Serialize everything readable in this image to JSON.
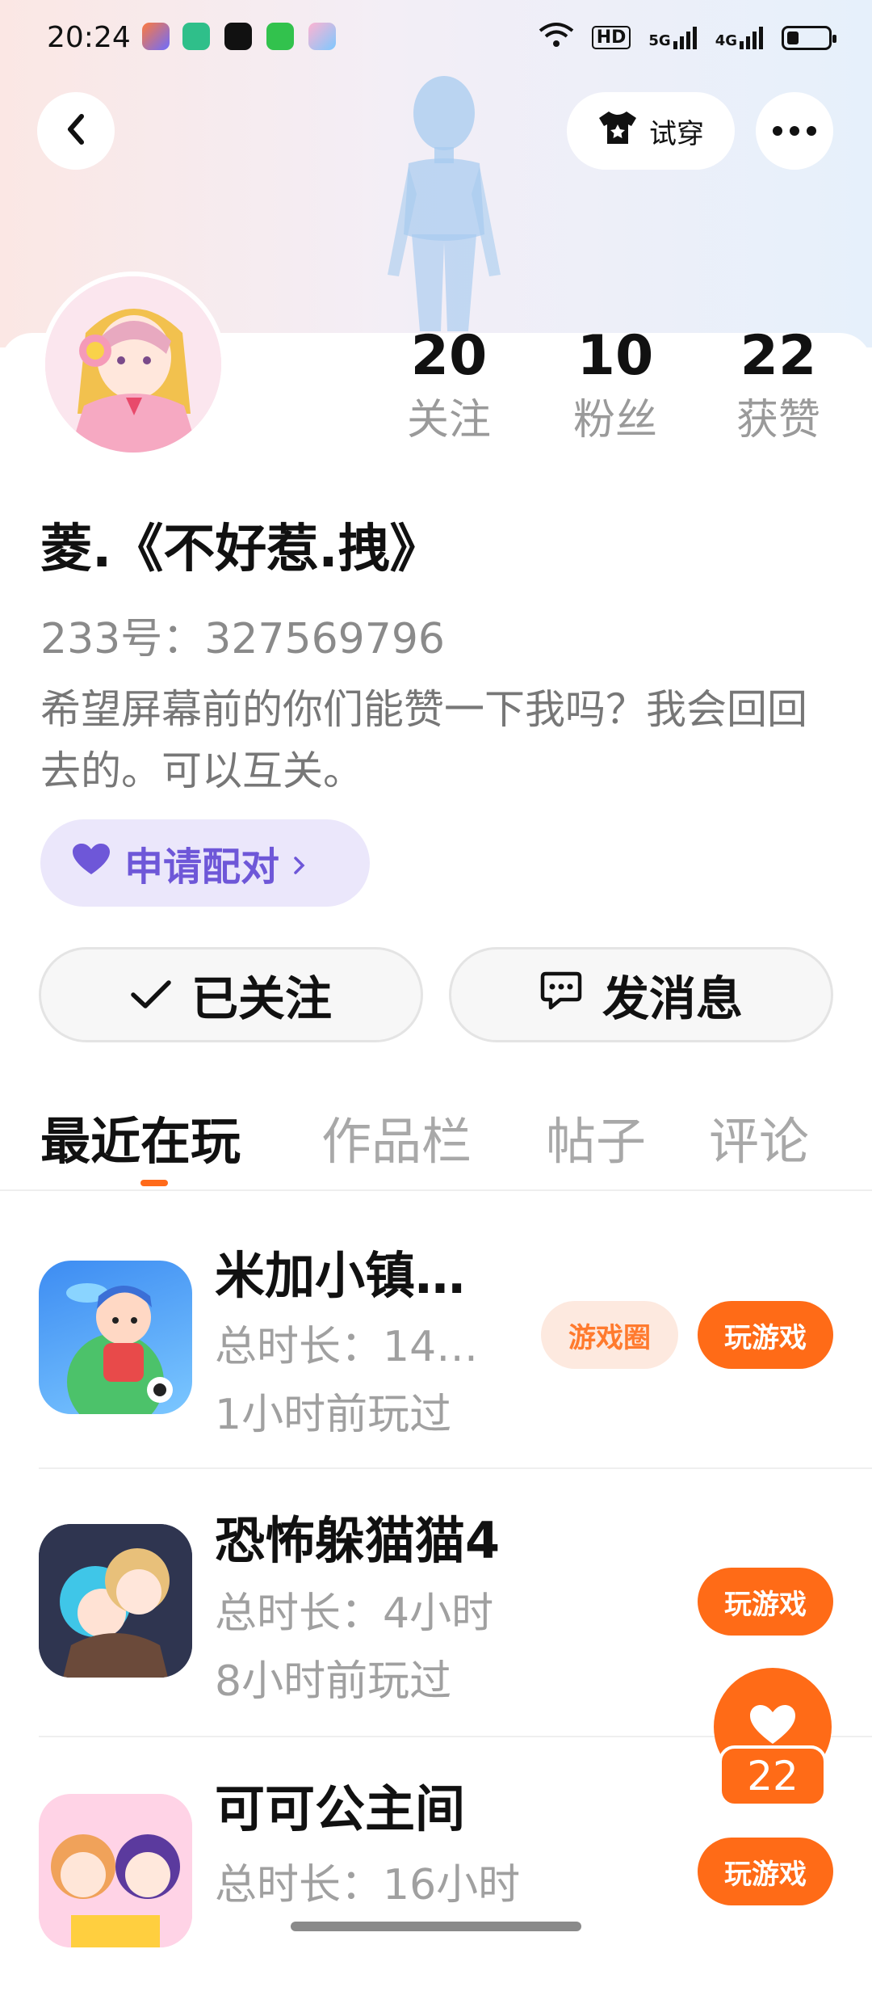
{
  "status_bar": {
    "time": "20:24",
    "network_1": "HD",
    "network_2": "5G",
    "network_3": "4G"
  },
  "header": {
    "back_icon": "chevron-left-icon",
    "try_on_label": "试穿",
    "more_icon": "more-icon"
  },
  "profile": {
    "stats": [
      {
        "value": "20",
        "label": "关注"
      },
      {
        "value": "10",
        "label": "粉丝"
      },
      {
        "value": "22",
        "label": "获赞"
      }
    ],
    "name": "菱.《不好惹.拽》",
    "id_line": "233号：327569796",
    "bio": "希望屏幕前的你们能赞一下我吗？我会回回去的。可以互关。",
    "pair_label": "申请配对",
    "follow_label": "已关注",
    "message_label": "发消息"
  },
  "tabs": [
    "最近在玩",
    "作品栏",
    "帖子",
    "评论"
  ],
  "games": [
    {
      "title": "米加小镇…",
      "duration": "总时长：14…",
      "last_played": "1小时前玩过",
      "circle_label": "游戏圈",
      "play_label": "玩游戏"
    },
    {
      "title": "恐怖躲猫猫4",
      "duration": "总时长：4小时",
      "last_played": "8小时前玩过",
      "play_label": "玩游戏"
    },
    {
      "title": "可可公主间",
      "duration": "总时长：16小时",
      "play_label": "玩游戏"
    }
  ],
  "like_fab": {
    "count": "22"
  },
  "colors": {
    "accent": "#ff6b17",
    "pair_bg": "#ebe7fb",
    "pair_text": "#6e57d8"
  }
}
